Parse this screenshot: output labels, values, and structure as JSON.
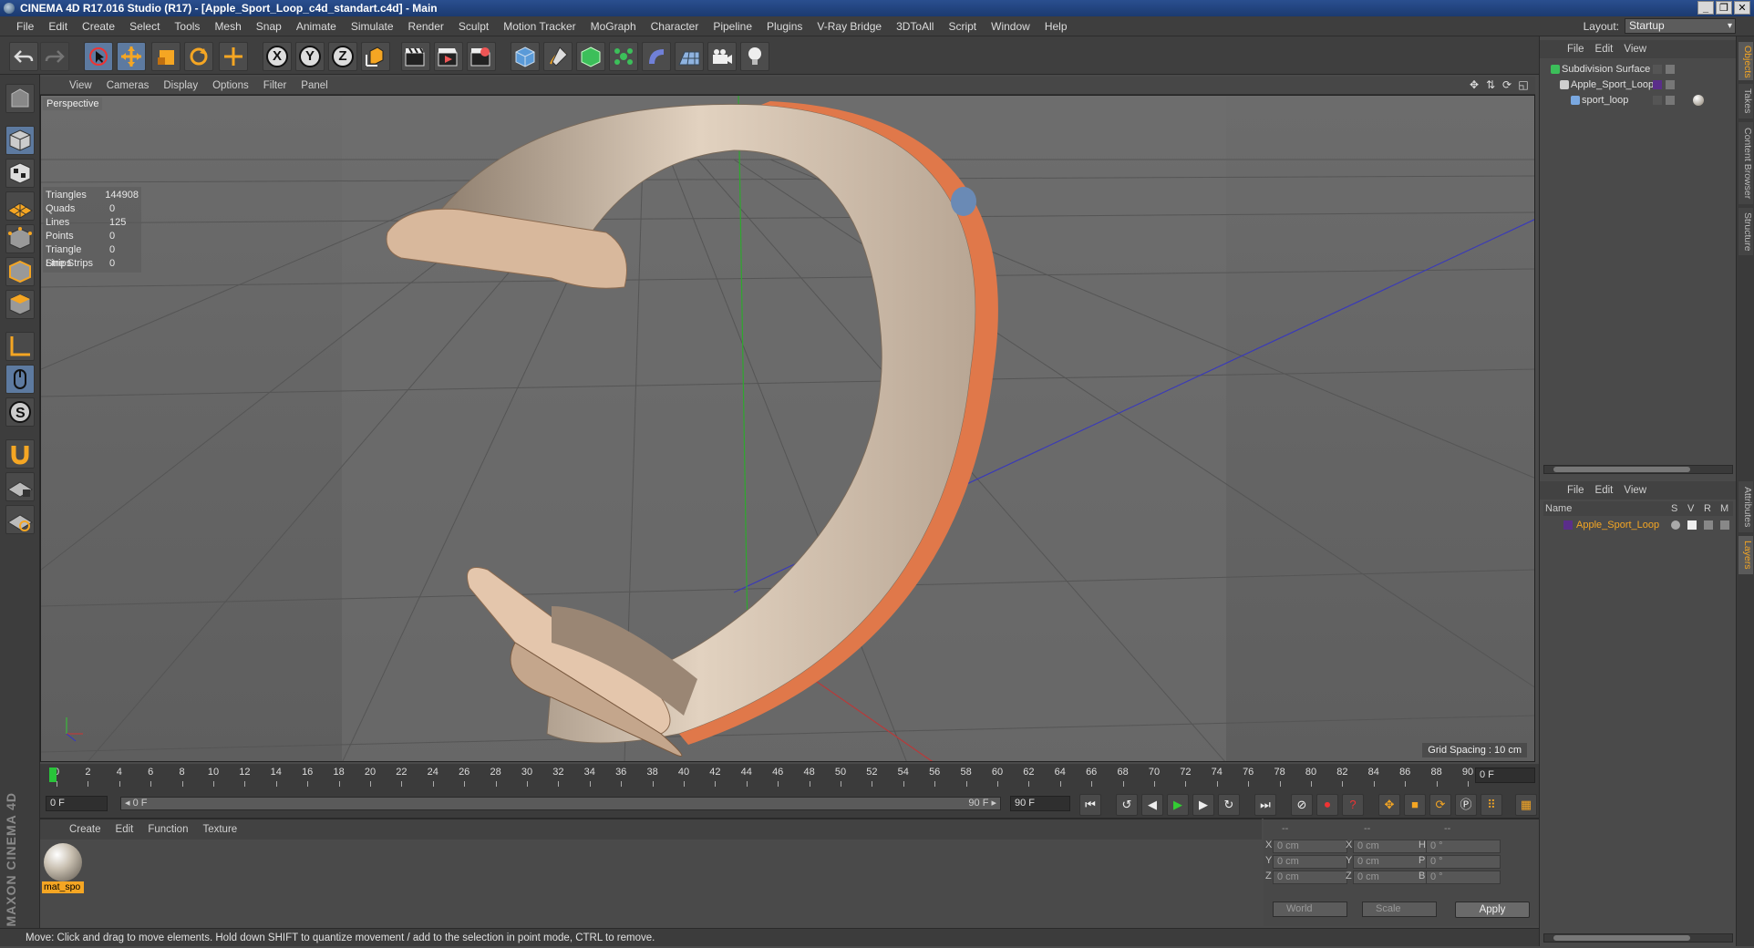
{
  "window": {
    "title": "CINEMA 4D R17.016 Studio (R17) - [Apple_Sport_Loop_c4d_standart.c4d] - Main",
    "controls": [
      "_",
      "❐",
      "✕"
    ]
  },
  "menubar": {
    "items": [
      "File",
      "Edit",
      "Create",
      "Select",
      "Tools",
      "Mesh",
      "Snap",
      "Animate",
      "Simulate",
      "Render",
      "Sculpt",
      "Motion Tracker",
      "MoGraph",
      "Character",
      "Pipeline",
      "Plugins",
      "V-Ray Bridge",
      "3DToAll",
      "Script",
      "Window",
      "Help"
    ],
    "layout_label": "Layout:",
    "layout_value": "Startup"
  },
  "toolbar": {
    "axis_x": "X",
    "axis_y": "Y",
    "axis_z": "Z"
  },
  "viewport": {
    "menu": [
      "View",
      "Cameras",
      "Display",
      "Options",
      "Filter",
      "Panel"
    ],
    "camera_label": "Perspective",
    "stats": [
      {
        "k": "Triangles",
        "v": "144908"
      },
      {
        "k": "Quads",
        "v": "0"
      },
      {
        "k": "Lines",
        "v": "125"
      },
      {
        "k": "Points",
        "v": "0"
      },
      {
        "k": "Triangle Strips",
        "v": "0"
      },
      {
        "k": "Line Strips",
        "v": "0"
      }
    ],
    "grid_spacing": "Grid Spacing : 10 cm",
    "colors": {
      "band": "#d8c6b4",
      "trim": "#e0784a",
      "pin": "#6a8ab5"
    }
  },
  "timeline": {
    "ticks": [
      "0",
      "2",
      "4",
      "6",
      "8",
      "10",
      "12",
      "14",
      "16",
      "18",
      "20",
      "22",
      "24",
      "26",
      "28",
      "30",
      "32",
      "34",
      "36",
      "38",
      "40",
      "42",
      "44",
      "46",
      "48",
      "50",
      "52",
      "54",
      "56",
      "58",
      "60",
      "62",
      "64",
      "66",
      "68",
      "70",
      "72",
      "74",
      "76",
      "78",
      "80",
      "82",
      "84",
      "86",
      "88",
      "90"
    ],
    "current_frame": "0 F",
    "start_field": "0 F",
    "range_start": "◂ 0 F",
    "range_end": "90 F ▸",
    "end_field": "90 F"
  },
  "material_manager": {
    "menu": [
      "Create",
      "Edit",
      "Function",
      "Texture"
    ],
    "materials": [
      {
        "name": "mat_spo"
      }
    ]
  },
  "coordinates": {
    "headers": [
      "--",
      "--",
      "--"
    ],
    "rows": [
      {
        "a1": "X",
        "v1": "0 cm",
        "a2": "X",
        "v2": "0 cm",
        "a3": "H",
        "v3": "0 °"
      },
      {
        "a1": "Y",
        "v1": "0 cm",
        "a2": "Y",
        "v2": "0 cm",
        "a3": "P",
        "v3": "0 °"
      },
      {
        "a1": "Z",
        "v1": "0 cm",
        "a2": "Z",
        "v2": "0 cm",
        "a3": "B",
        "v3": "0 °"
      }
    ],
    "space": "World",
    "mode": "Scale",
    "apply": "Apply"
  },
  "status": "Move: Click and drag to move elements. Hold down SHIFT to quantize movement / add to the selection in point mode, CTRL to remove.",
  "objects_panel": {
    "menu": [
      "File",
      "Edit",
      "View"
    ],
    "items": [
      {
        "name": "Subdivision Surface"
      },
      {
        "name": "Apple_Sport_Loop"
      },
      {
        "name": "sport_loop"
      }
    ]
  },
  "layers_panel": {
    "menu": [
      "File",
      "Edit",
      "View"
    ],
    "col_name": "Name",
    "cols": [
      "S",
      "V",
      "R",
      "M"
    ],
    "items": [
      {
        "name": "Apple_Sport_Loop"
      }
    ]
  },
  "side_tabs": [
    "Objects",
    "Takes",
    "Content Browser",
    "Structure"
  ],
  "side_tabs_lower": [
    "Attributes",
    "Layers"
  ],
  "branding": "MAXON CINEMA 4D"
}
